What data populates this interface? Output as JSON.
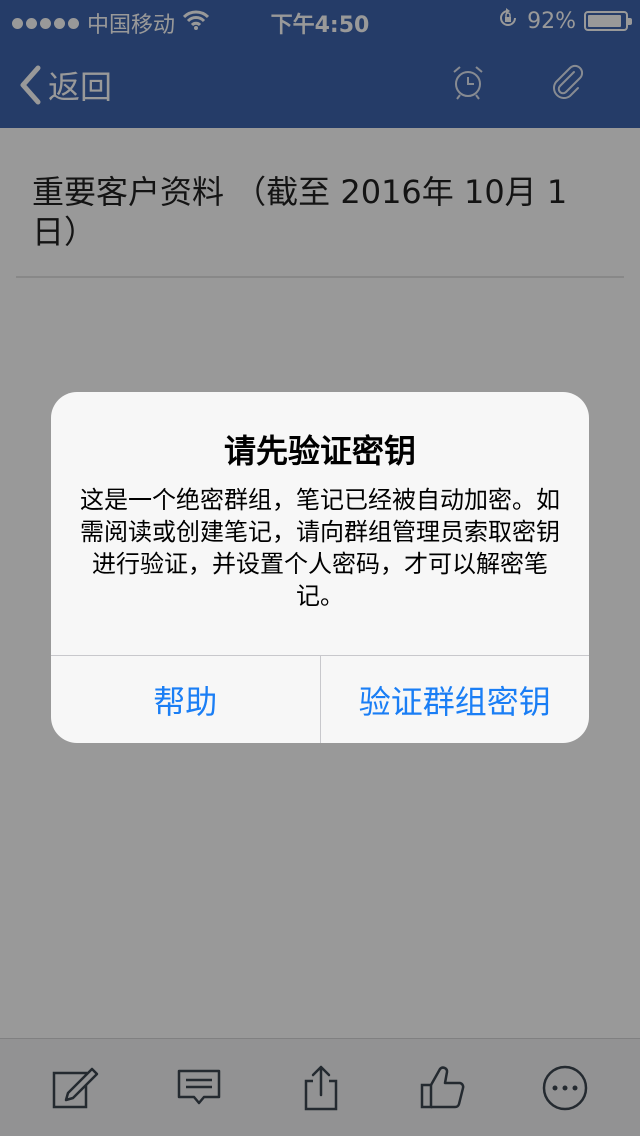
{
  "status_bar": {
    "carrier": "中国移动",
    "time": "下午4:50",
    "battery_percent": "92%",
    "battery_level": 0.92
  },
  "nav_bar": {
    "back_label": "返回",
    "icons": [
      "alarm-clock-icon",
      "paperclip-icon"
    ]
  },
  "note": {
    "title": "重要客户资料 （截至 2016年 10月 1日）"
  },
  "toolbar": {
    "icons": [
      "compose-icon",
      "comment-icon",
      "share-icon",
      "like-icon",
      "more-icon"
    ]
  },
  "alert": {
    "title": "请先验证密钥",
    "message": "这是一个绝密群组，笔记已经被自动加密。如需阅读或创建笔记，请向群组管理员索取密钥进行验证，并设置个人密码，才可以解密笔记。",
    "buttons": {
      "help": "帮助",
      "verify": "验证群组密钥"
    }
  },
  "colors": {
    "nav_background": "#3e64ad",
    "alert_button_text": "#1a7ef5",
    "dim_overlay": "rgba(0,0,0,0.4)"
  }
}
